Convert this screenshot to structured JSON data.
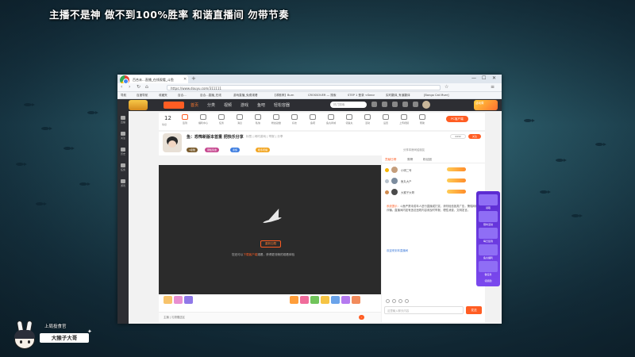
{
  "stream": {
    "title": "主播不是神 做不到100%胜率  和谐直播间  勿带节奏",
    "overlay_name": "大猴子大哥",
    "overlay_subtitle": "上局投食官"
  },
  "browser": {
    "tab_title": "百合未...直播_在线观看_斗鱼",
    "url": "https://www.douyu.com/311111",
    "bookmarks": [
      "导航",
      "百度导航",
      "收藏夹",
      "百合...",
      "百合...直播_在线",
      "游戏直播_免费观看",
      "【求推荐】Burn",
      "CROSSOVER — 搜索",
      "STEP 1 登录 <Sea>",
      "实时翻译_有道翻译",
      "[Bongo Cat Mver]"
    ]
  },
  "site": {
    "nav": [
      "首页",
      "分类",
      "视频",
      "游戏",
      "鱼吧",
      "轻松容器"
    ],
    "search_placeholder": "热门搜索",
    "promo_label": "活动周",
    "level": "12",
    "level_caption": "等级",
    "toolbar": [
      "签到",
      "福利中心",
      "任务",
      "消息",
      "私信",
      "粉丝勋章",
      "好友",
      "鱼吧",
      "鱼丸商城",
      "领鱼丸",
      "活动",
      "设置",
      "上传视频",
      "帮助"
    ],
    "pc_button": "PC客户端",
    "room_title": "鱼：恐怖新版本首重 把快乐分享",
    "room_meta": "标签 | 闲时游戏 | 举报 | 分享",
    "badges": [
      "1级徽",
      "钢板奖章",
      "贵族",
      "暖冬祝福"
    ],
    "follow_label": "关注",
    "follow_count": "4432",
    "share_text": "分享本房间给朋友",
    "refresh_button": "重新加载",
    "player_msg_prefix": "您还可以",
    "player_msg_link": "下载客户端",
    "player_msg_suffix": "观看，获得更流畅的观看体验",
    "gift_input": "主播 | 礼物赠送区",
    "chat_tabs": [
      "贡献日榜",
      "周榜",
      "粉丝团"
    ],
    "ranks": [
      {
        "name": "小明二号"
      },
      {
        "name": "鱼丸大户"
      },
      {
        "name": "大猴子大哥"
      }
    ],
    "chat_system": "系统提示：",
    "chat_system_text": "斗鱼严禁未成年人进行直播或打赏，请勿轻信各类广告，警惕网络诈骗。直播间内如有违法违规内容请及时举报，理性消费，文明发言。",
    "chat_tip": "欢迎来到本直播间",
    "chat_input_placeholder": "这里输入聊天内容",
    "send_label": "发送",
    "side_labels": [
      "直播",
      "关注",
      "历史",
      "任务",
      "游戏"
    ],
    "promo_side": [
      "领取",
      "限时活动",
      "每日签到",
      "鱼丸福利",
      "做任务",
      "领奖励"
    ]
  }
}
